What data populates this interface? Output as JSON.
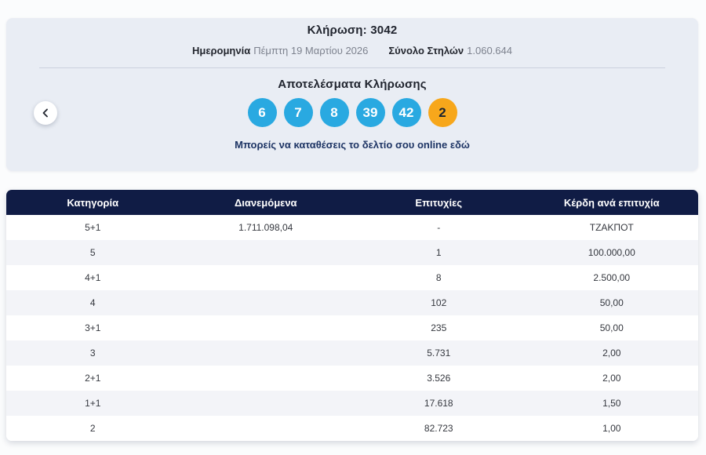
{
  "draw": {
    "title_label": "Κλήρωση:",
    "title_value": "3042",
    "date_label": "Ημερομηνία",
    "date_value": "Πέμπτη 19 Μαρτίου 2026",
    "columns_label": "Σύνολο Στηλών",
    "columns_value": "1.060.644"
  },
  "results": {
    "heading": "Αποτελέσματα Κλήρωσης",
    "numbers": [
      "6",
      "7",
      "8",
      "39",
      "42"
    ],
    "bonus_number": "2",
    "link_text": "Μπορείς να καταθέσεις το δελτίο σου online εδώ"
  },
  "table": {
    "headers": [
      "Κατηγορία",
      "Διανεμόμενα",
      "Επιτυχίες",
      "Κέρδη ανά επιτυχία"
    ],
    "rows": [
      [
        "5+1",
        "1.711.098,04",
        "-",
        "ΤΖΑΚΠΟΤ"
      ],
      [
        "5",
        "",
        "1",
        "100.000,00"
      ],
      [
        "4+1",
        "",
        "8",
        "2.500,00"
      ],
      [
        "4",
        "",
        "102",
        "50,00"
      ],
      [
        "3+1",
        "",
        "235",
        "50,00"
      ],
      [
        "3",
        "",
        "5.731",
        "2,00"
      ],
      [
        "2+1",
        "",
        "3.526",
        "2,00"
      ],
      [
        "1+1",
        "",
        "17.618",
        "1,50"
      ],
      [
        "2",
        "",
        "82.723",
        "1,00"
      ]
    ]
  },
  "colors": {
    "number_ball": "#29a9e1",
    "bonus_ball": "#f7a71b",
    "table_header": "#101c45",
    "card_background": "#e9edf4",
    "row_alt": "#f3f4f8"
  }
}
